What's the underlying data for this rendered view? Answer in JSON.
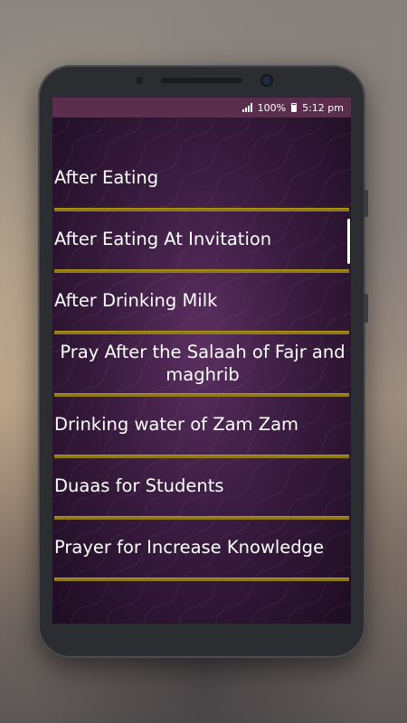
{
  "status_bar": {
    "battery": "100%",
    "time": "5:12 pm"
  },
  "list": {
    "items": [
      {
        "label": "After Eating"
      },
      {
        "label": "After Eating At Invitation"
      },
      {
        "label": "After Drinking Milk"
      },
      {
        "label": "Pray After the Salaah of Fajr and maghrib"
      },
      {
        "label": "Drinking water of Zam Zam"
      },
      {
        "label": "Duaas for Students"
      },
      {
        "label": "Prayer for Increase Knowledge"
      }
    ]
  },
  "colors": {
    "status_bar": "#5c2e4e",
    "divider": "#8f7a13",
    "background": "#3a1c40"
  }
}
